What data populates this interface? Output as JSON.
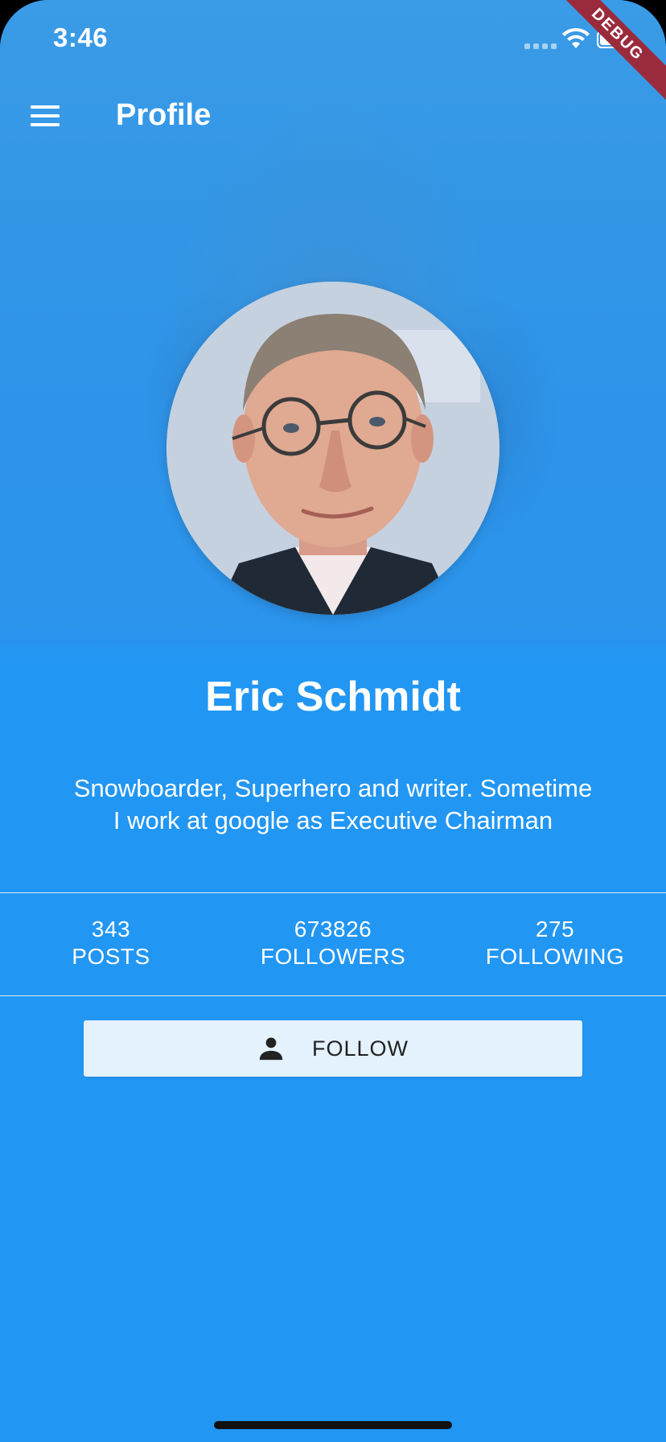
{
  "status_bar": {
    "time": "3:46",
    "debug_label": "DEBUG"
  },
  "app_bar": {
    "title": "Profile",
    "menu_icon": "hamburger-menu-icon"
  },
  "profile": {
    "name": "Eric Schmidt",
    "bio": "Snowboarder, Superhero and writer. Sometime I work at google as Executive Chairman",
    "avatar_alt": "profile photo"
  },
  "stats": [
    {
      "value": "343",
      "label": "POSTS"
    },
    {
      "value": "673826",
      "label": "FOLLOWERS"
    },
    {
      "value": "275",
      "label": "FOLLOWING"
    }
  ],
  "follow_button": {
    "label": "FOLLOW",
    "icon": "person-icon"
  },
  "colors": {
    "primary": "#2196F3",
    "button_bg": "#E3F2FD",
    "debug_ribbon": "#9A2B3C"
  }
}
